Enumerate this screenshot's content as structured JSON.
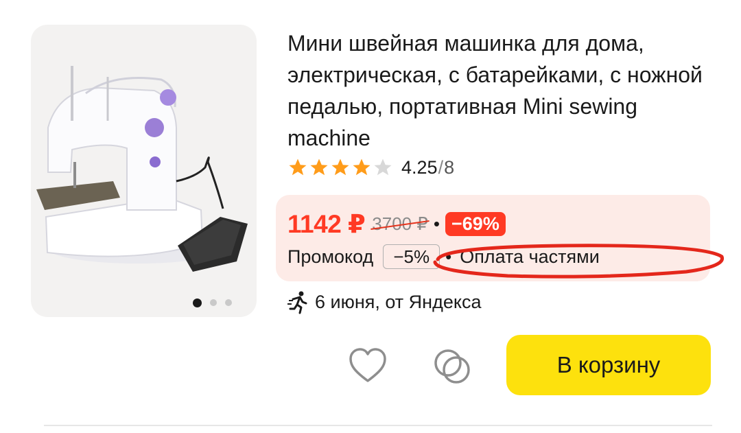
{
  "product": {
    "title": "Мини швейная машинка для дома, электрическая, с батарейками, с ножной педалью, портативная Mini sewing machine",
    "image_alt": "sewing-machine-photo",
    "gallery": {
      "total": 3,
      "active": 1
    }
  },
  "rating": {
    "value": "4.25",
    "separator": "/",
    "count": "8",
    "stars_filled": 4.25,
    "stars_total": 5
  },
  "price": {
    "current": "1142 ₽",
    "old": "3700 ₽",
    "bullet": "•",
    "discount": "−69%",
    "promo_label": "Промокод",
    "promo_value": "−5%",
    "installment": "Оплата частями"
  },
  "delivery": {
    "icon": "running-person-icon",
    "text": "6 июня, от Яндекса"
  },
  "actions": {
    "favorite_icon": "heart-icon",
    "compare_icon": "compare-circles-icon",
    "cart_label": "В корзину"
  },
  "colors": {
    "price": "#ff3a24",
    "cart": "#fde10d",
    "price_box": "#fdebe7",
    "annotation": "#e4271b"
  }
}
